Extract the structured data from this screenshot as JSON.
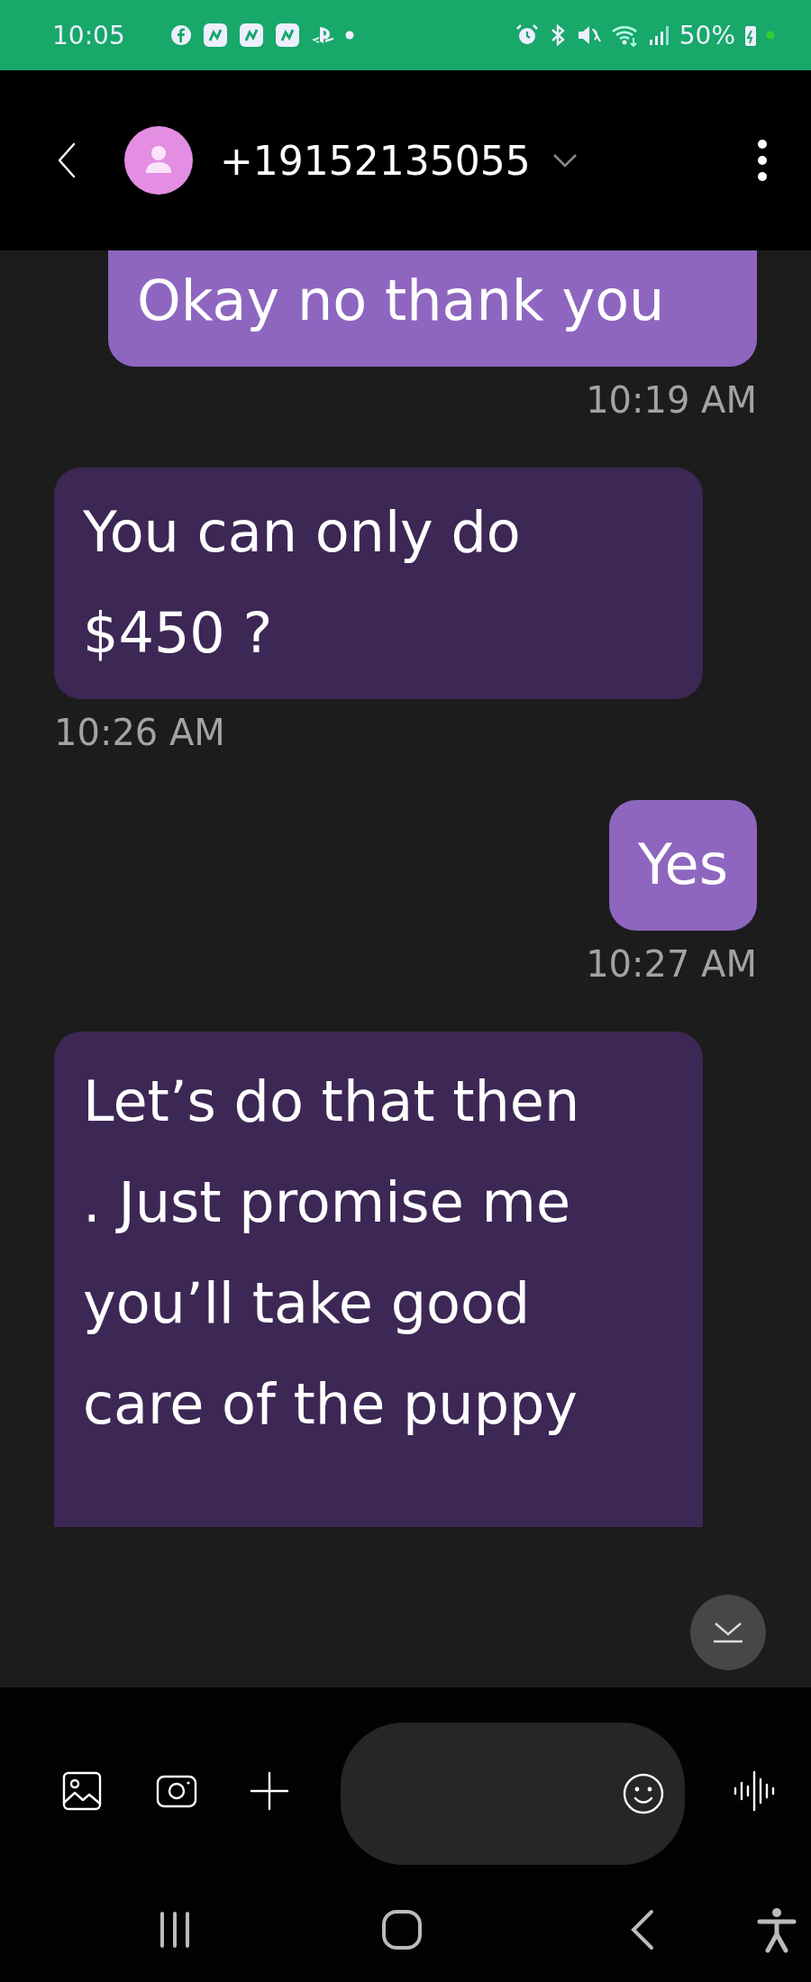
{
  "status_bar": {
    "time": "10:05",
    "battery": "50%"
  },
  "header": {
    "contact": "+19152135055"
  },
  "messages": [
    {
      "kind": "sent",
      "text": "Okay no thank you",
      "time": "10:19 AM"
    },
    {
      "kind": "received",
      "text": "You can only do $450 ?",
      "time": "10:26 AM"
    },
    {
      "kind": "sent",
      "text": "Yes",
      "time": "10:27 AM"
    },
    {
      "kind": "received",
      "text": "Let’s do that then . Just promise me you’ll take good care of the puppy"
    }
  ]
}
